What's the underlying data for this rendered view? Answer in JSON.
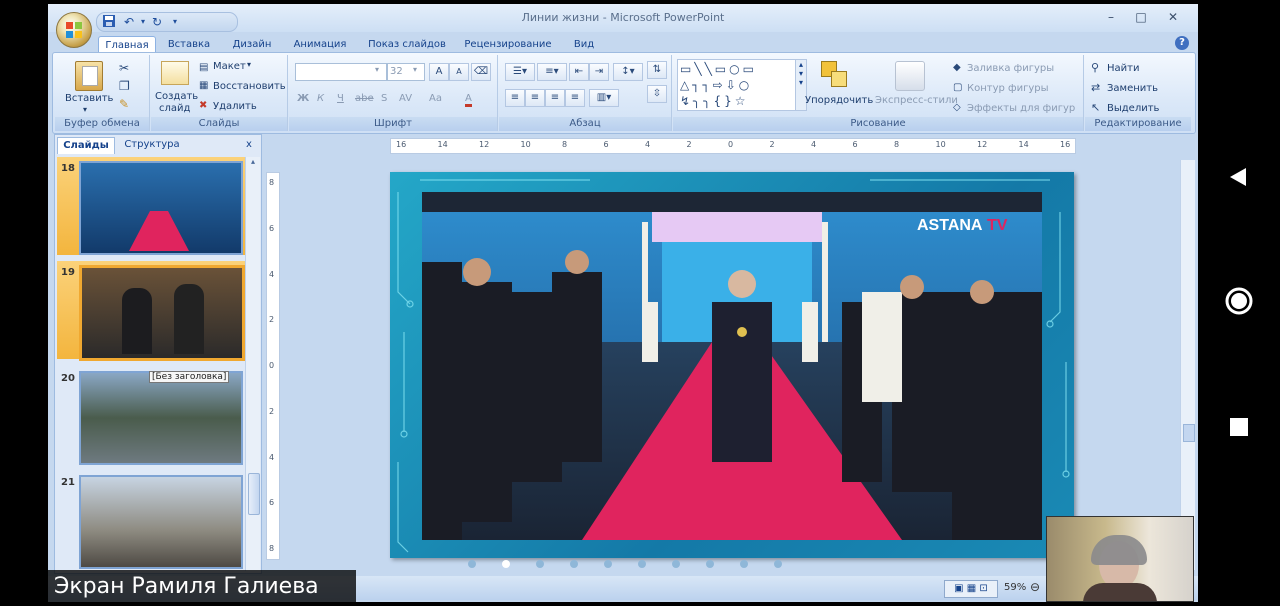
{
  "app": {
    "title": "Линии жизни - Microsoft PowerPoint",
    "window_controls": [
      "–",
      "□",
      "✕"
    ]
  },
  "tabs": [
    "Главная",
    "Вставка",
    "Дизайн",
    "Анимация",
    "Показ слайдов",
    "Рецензирование",
    "Вид"
  ],
  "active_tab": "Главная",
  "ribbon": {
    "clipboard": {
      "paste": "Вставить",
      "label": "Буфер обмена"
    },
    "slides": {
      "create": "Создать",
      "create2": "слайд",
      "layout": "Макет",
      "reset": "Восстановить",
      "delete": "Удалить",
      "label": "Слайды"
    },
    "font": {
      "size": "32",
      "grow": "A",
      "shrink": "A",
      "bold": "Ж",
      "italic": "К",
      "underline": "Ч",
      "strike": "abe",
      "shadow": "S",
      "spacing": "AV",
      "case": "Aa",
      "color": "A",
      "label": "Шрифт"
    },
    "paragraph": {
      "label": "Абзац"
    },
    "drawing": {
      "arrange": "Упорядочить",
      "styles": "Экспресс-стили",
      "fill": "Заливка фигуры",
      "outline": "Контур фигуры",
      "effects": "Эффекты для фигур",
      "label": "Рисование"
    },
    "editing": {
      "find": "Найти",
      "replace": "Заменить",
      "select": "Выделить",
      "label": "Редактирование"
    }
  },
  "panel": {
    "tabs": [
      "Слайды",
      "Структура"
    ],
    "close": "x",
    "slides": [
      {
        "number": "18"
      },
      {
        "number": "19"
      },
      {
        "number": "20",
        "tooltip": "[Без заголовка]"
      },
      {
        "number": "21"
      }
    ]
  },
  "ruler": {
    "h_ticks": [
      "16",
      "14",
      "12",
      "10",
      "8",
      "6",
      "4",
      "2",
      "0",
      "2",
      "4",
      "6",
      "8",
      "10",
      "12",
      "14",
      "16"
    ],
    "v_ticks": [
      "8",
      "6",
      "4",
      "2",
      "0",
      "2",
      "4",
      "6",
      "8"
    ]
  },
  "slide": {
    "watermark": "ASTANA",
    "watermark_suffix": "TV"
  },
  "status": {
    "zoom": "59%",
    "minus": "⊖"
  },
  "overlay": {
    "presenter": "Экран Рамиля Галиева"
  },
  "colors": {
    "accent": "#15428b",
    "ribbon": "#dbe8f8",
    "selection": "#f0a830",
    "carpet": "#e0245e"
  }
}
